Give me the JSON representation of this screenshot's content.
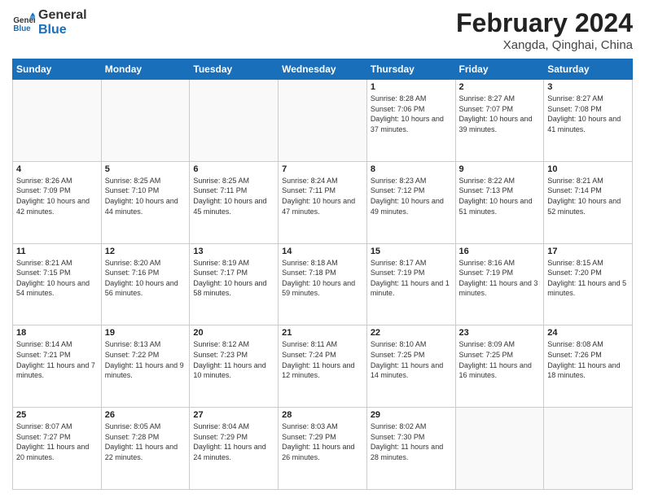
{
  "header": {
    "logo_line1": "General",
    "logo_line2": "Blue",
    "month_title": "February 2024",
    "subtitle": "Xangda, Qinghai, China"
  },
  "weekdays": [
    "Sunday",
    "Monday",
    "Tuesday",
    "Wednesday",
    "Thursday",
    "Friday",
    "Saturday"
  ],
  "weeks": [
    [
      {
        "day": "",
        "info": ""
      },
      {
        "day": "",
        "info": ""
      },
      {
        "day": "",
        "info": ""
      },
      {
        "day": "",
        "info": ""
      },
      {
        "day": "1",
        "info": "Sunrise: 8:28 AM\nSunset: 7:06 PM\nDaylight: 10 hours\nand 37 minutes."
      },
      {
        "day": "2",
        "info": "Sunrise: 8:27 AM\nSunset: 7:07 PM\nDaylight: 10 hours\nand 39 minutes."
      },
      {
        "day": "3",
        "info": "Sunrise: 8:27 AM\nSunset: 7:08 PM\nDaylight: 10 hours\nand 41 minutes."
      }
    ],
    [
      {
        "day": "4",
        "info": "Sunrise: 8:26 AM\nSunset: 7:09 PM\nDaylight: 10 hours\nand 42 minutes."
      },
      {
        "day": "5",
        "info": "Sunrise: 8:25 AM\nSunset: 7:10 PM\nDaylight: 10 hours\nand 44 minutes."
      },
      {
        "day": "6",
        "info": "Sunrise: 8:25 AM\nSunset: 7:11 PM\nDaylight: 10 hours\nand 45 minutes."
      },
      {
        "day": "7",
        "info": "Sunrise: 8:24 AM\nSunset: 7:11 PM\nDaylight: 10 hours\nand 47 minutes."
      },
      {
        "day": "8",
        "info": "Sunrise: 8:23 AM\nSunset: 7:12 PM\nDaylight: 10 hours\nand 49 minutes."
      },
      {
        "day": "9",
        "info": "Sunrise: 8:22 AM\nSunset: 7:13 PM\nDaylight: 10 hours\nand 51 minutes."
      },
      {
        "day": "10",
        "info": "Sunrise: 8:21 AM\nSunset: 7:14 PM\nDaylight: 10 hours\nand 52 minutes."
      }
    ],
    [
      {
        "day": "11",
        "info": "Sunrise: 8:21 AM\nSunset: 7:15 PM\nDaylight: 10 hours\nand 54 minutes."
      },
      {
        "day": "12",
        "info": "Sunrise: 8:20 AM\nSunset: 7:16 PM\nDaylight: 10 hours\nand 56 minutes."
      },
      {
        "day": "13",
        "info": "Sunrise: 8:19 AM\nSunset: 7:17 PM\nDaylight: 10 hours\nand 58 minutes."
      },
      {
        "day": "14",
        "info": "Sunrise: 8:18 AM\nSunset: 7:18 PM\nDaylight: 10 hours\nand 59 minutes."
      },
      {
        "day": "15",
        "info": "Sunrise: 8:17 AM\nSunset: 7:19 PM\nDaylight: 11 hours\nand 1 minute."
      },
      {
        "day": "16",
        "info": "Sunrise: 8:16 AM\nSunset: 7:19 PM\nDaylight: 11 hours\nand 3 minutes."
      },
      {
        "day": "17",
        "info": "Sunrise: 8:15 AM\nSunset: 7:20 PM\nDaylight: 11 hours\nand 5 minutes."
      }
    ],
    [
      {
        "day": "18",
        "info": "Sunrise: 8:14 AM\nSunset: 7:21 PM\nDaylight: 11 hours\nand 7 minutes."
      },
      {
        "day": "19",
        "info": "Sunrise: 8:13 AM\nSunset: 7:22 PM\nDaylight: 11 hours\nand 9 minutes."
      },
      {
        "day": "20",
        "info": "Sunrise: 8:12 AM\nSunset: 7:23 PM\nDaylight: 11 hours\nand 10 minutes."
      },
      {
        "day": "21",
        "info": "Sunrise: 8:11 AM\nSunset: 7:24 PM\nDaylight: 11 hours\nand 12 minutes."
      },
      {
        "day": "22",
        "info": "Sunrise: 8:10 AM\nSunset: 7:25 PM\nDaylight: 11 hours\nand 14 minutes."
      },
      {
        "day": "23",
        "info": "Sunrise: 8:09 AM\nSunset: 7:25 PM\nDaylight: 11 hours\nand 16 minutes."
      },
      {
        "day": "24",
        "info": "Sunrise: 8:08 AM\nSunset: 7:26 PM\nDaylight: 11 hours\nand 18 minutes."
      }
    ],
    [
      {
        "day": "25",
        "info": "Sunrise: 8:07 AM\nSunset: 7:27 PM\nDaylight: 11 hours\nand 20 minutes."
      },
      {
        "day": "26",
        "info": "Sunrise: 8:05 AM\nSunset: 7:28 PM\nDaylight: 11 hours\nand 22 minutes."
      },
      {
        "day": "27",
        "info": "Sunrise: 8:04 AM\nSunset: 7:29 PM\nDaylight: 11 hours\nand 24 minutes."
      },
      {
        "day": "28",
        "info": "Sunrise: 8:03 AM\nSunset: 7:29 PM\nDaylight: 11 hours\nand 26 minutes."
      },
      {
        "day": "29",
        "info": "Sunrise: 8:02 AM\nSunset: 7:30 PM\nDaylight: 11 hours\nand 28 minutes."
      },
      {
        "day": "",
        "info": ""
      },
      {
        "day": "",
        "info": ""
      }
    ]
  ]
}
